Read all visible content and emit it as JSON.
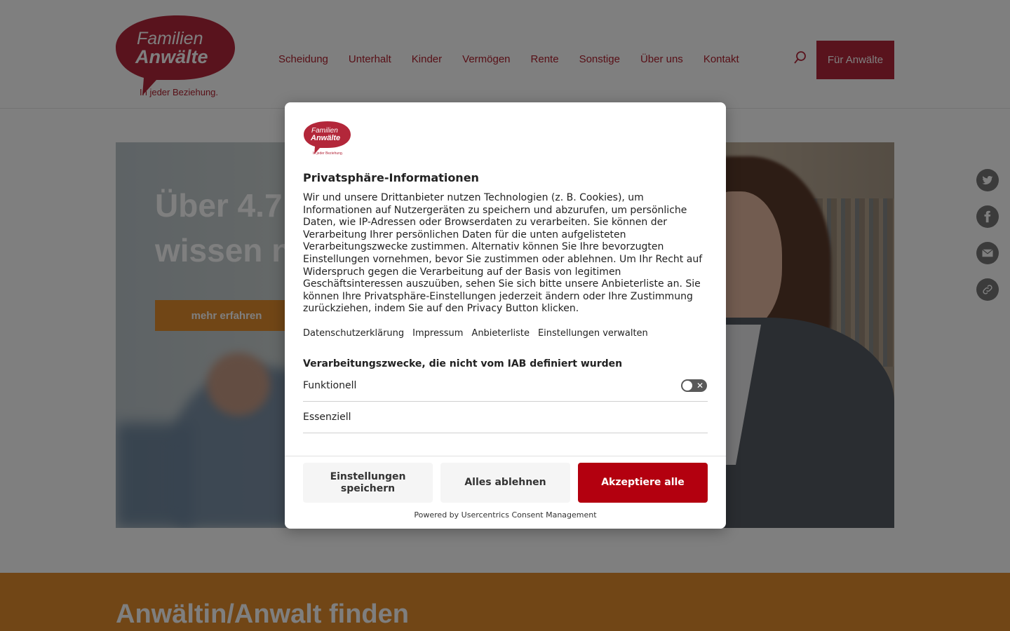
{
  "header": {
    "logo": {
      "line1": "Familien",
      "line2": "Anwälte",
      "tagline": "In jeder Beziehung."
    },
    "nav": [
      "Scheidung",
      "Unterhalt",
      "Kinder",
      "Vermögen",
      "Rente",
      "Sonstige",
      "Über uns",
      "Kontakt"
    ],
    "search_icon": "search-icon",
    "cta_label": "Für Anwälte"
  },
  "hero": {
    "title_line1": "Über 4.7",
    "title_line2": "wissen n",
    "button_label": "mehr erfahren"
  },
  "share": {
    "icons": [
      "twitter-icon",
      "facebook-icon",
      "mail-icon",
      "link-icon"
    ]
  },
  "finder": {
    "title": "Anwältin/Anwalt finden"
  },
  "consent": {
    "logo": {
      "line1": "Familien",
      "line2": "Anwälte",
      "tagline": "In jeder Beziehung."
    },
    "title": "Privatsphäre-Informationen",
    "body": "Wir und unsere Drittanbieter nutzen Technologien (z. B. Cookies), um Informationen auf Nutzergeräten zu speichern und abzurufen, um persönliche Daten, wie IP-Adressen oder Browserdaten zu verarbeiten. Sie können der Verarbeitung Ihrer persönlichen Daten für die unten aufgelisteten Verarbeitungszwecke zustimmen. Alternativ können Sie Ihre bevorzugten Einstellungen vornehmen, bevor Sie zustimmen oder ablehnen. Um Ihr Recht auf Widerspruch gegen die Verarbeitung auf der Basis von legitimen Geschäftsinteressen auszuüben, sehen Sie sich bitte unsere Anbieterliste an. Sie können Ihre Privatsphäre-Einstellungen jederzeit ändern oder Ihre Zustimmung zurückziehen, indem Sie auf den Privacy Button klicken.",
    "links": [
      "Datenschutzerklärung",
      "Impressum",
      "Anbieterliste",
      "Einstellungen verwalten"
    ],
    "section_title": "Verarbeitungszwecke, die nicht vom IAB definiert wurden",
    "purposes": [
      {
        "label": "Funktionell",
        "enabled": false
      },
      {
        "label": "Essenziell"
      }
    ],
    "buttons": {
      "save": "Einstellungen speichern",
      "reject": "Alles ablehnen",
      "accept": "Akzeptiere alle"
    },
    "powered_by": "Powered by Usercentrics Consent Management"
  },
  "colors": {
    "brand_red": "#b3273a",
    "accent_orange": "#e28c2c",
    "accept_red": "#b3000f"
  }
}
